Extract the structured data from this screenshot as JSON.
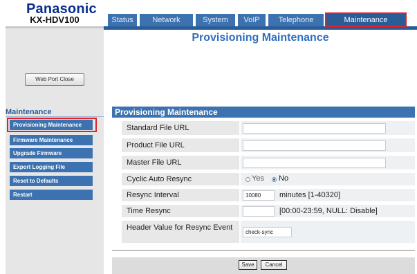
{
  "brand": "Panasonic",
  "model": "KX-HDV100",
  "tabs": [
    {
      "label": "Status"
    },
    {
      "label": "Network"
    },
    {
      "label": "System"
    },
    {
      "label": "VoIP"
    },
    {
      "label": "Telephone"
    },
    {
      "label": "Maintenance"
    }
  ],
  "web_port_close": "Web Port Close",
  "nav": {
    "title": "Maintenance",
    "items": [
      {
        "label": "Provisioning Maintenance"
      },
      {
        "label": "Firmware Maintenance"
      },
      {
        "label": "Upgrade Firmware"
      },
      {
        "label": "Export Logging File"
      },
      {
        "label": "Reset to Defaults"
      },
      {
        "label": "Restart"
      }
    ]
  },
  "page_title": "Provisioning Maintenance",
  "section_title": "Provisioning Maintenance",
  "fields": {
    "standard_file_url": {
      "label": "Standard File URL",
      "value": ""
    },
    "product_file_url": {
      "label": "Product File URL",
      "value": ""
    },
    "master_file_url": {
      "label": "Master File URL",
      "value": ""
    },
    "cyclic_auto_resync": {
      "label": "Cyclic Auto Resync",
      "yes": "Yes",
      "no": "No",
      "selected": "No"
    },
    "resync_interval": {
      "label": "Resync Interval",
      "value": "10080",
      "hint": "minutes [1-40320]"
    },
    "time_resync": {
      "label": "Time Resync",
      "value": "",
      "hint": "[00:00-23:59, NULL: Disable]"
    },
    "header_value": {
      "label": "Header Value for Resync Event",
      "value": "check-sync"
    }
  },
  "buttons": {
    "save": "Save",
    "cancel": "Cancel"
  },
  "colors": {
    "tab_bar": "#2a5d98",
    "tab": "#3d72b0",
    "highlight": "#e0202a",
    "title": "#2e6fbd",
    "brand": "#0a2f8f"
  }
}
